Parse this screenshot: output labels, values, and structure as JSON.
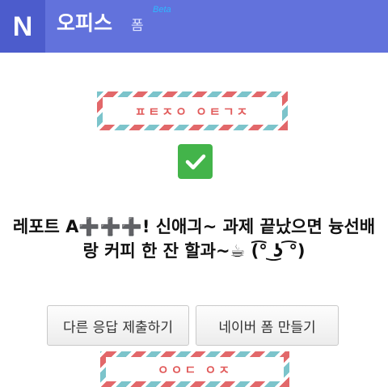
{
  "header": {
    "logo": "N",
    "title": "오피스",
    "subtitle": "폼",
    "badge": "Beta"
  },
  "top_banner": {
    "text": "ㅍㅌㅈㅇ ㅇㅌㄱㅈ"
  },
  "message": {
    "line1": "레포트 A➕➕➕! 신애긔~ 과제 끝났으면 늉선배",
    "line2": "랑 커피 한 잔 할과~☕ (͡° ͜ʖ ͡°)"
  },
  "buttons": {
    "submit_another": "다른 응답 제출하기",
    "create_form": "네이버 폼 만들기"
  },
  "bottom_banner": {
    "text": "ㅇㅇㄷ ㅇㅈ"
  },
  "colors": {
    "header": "#6272dc",
    "logo_bg": "#4c5ccc",
    "check": "#43b44a",
    "stripe_red": "#e2686a",
    "stripe_teal": "#7cc4cb"
  }
}
